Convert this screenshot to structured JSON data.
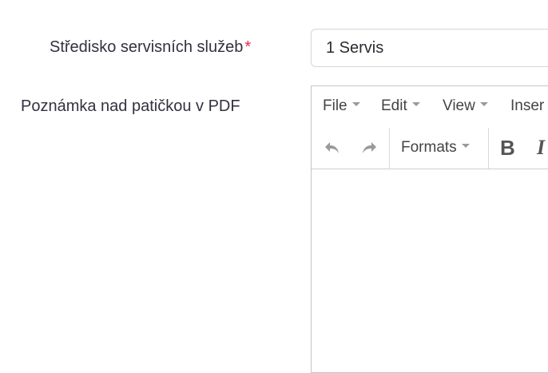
{
  "form": {
    "service_center": {
      "label": "Středisko servisních služeb",
      "required_marker": "*",
      "value": "1 Servis"
    },
    "pdf_note": {
      "label": "Poznámka nad patičkou v PDF"
    }
  },
  "editor": {
    "menu": {
      "file": "File",
      "edit": "Edit",
      "view": "View",
      "insert": "Inser"
    },
    "toolbar": {
      "undo_icon": "undo-icon",
      "redo_icon": "redo-icon",
      "formats": "Formats",
      "bold": "B",
      "italic": "I"
    },
    "content": ""
  }
}
